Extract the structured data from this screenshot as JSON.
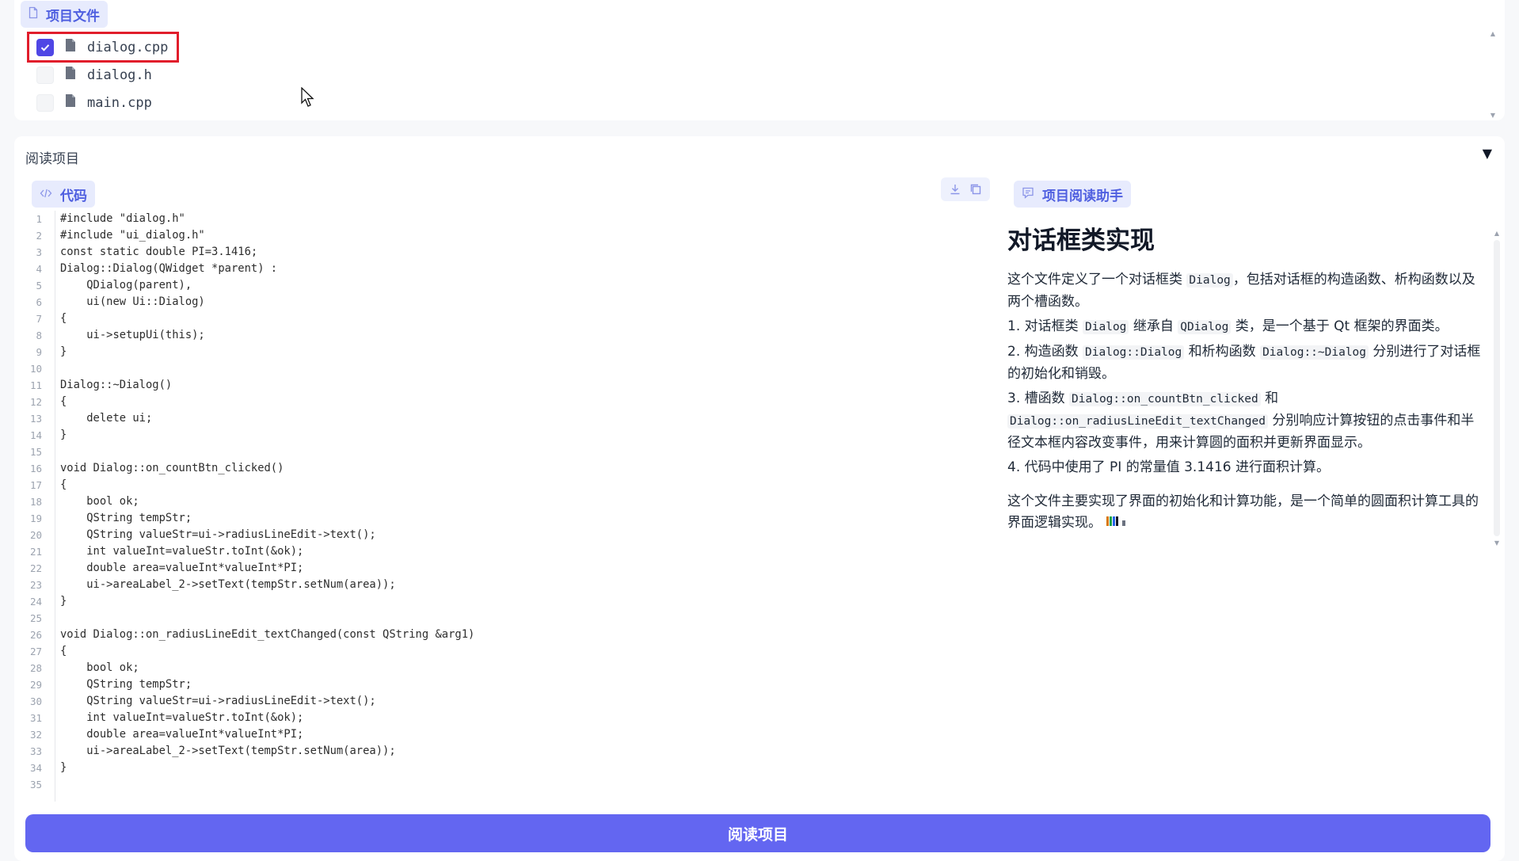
{
  "files_panel": {
    "label": "项目文件",
    "files": [
      {
        "name": "dialog.cpp",
        "checked": true
      },
      {
        "name": "dialog.h",
        "checked": false
      },
      {
        "name": "main.cpp",
        "checked": false
      }
    ]
  },
  "read_panel": {
    "header": "阅读项目",
    "collapse_icon": "▼",
    "code_label": "代码",
    "assistant_label": "项目阅读助手",
    "code_lines": [
      "#include \"dialog.h\"",
      "#include \"ui_dialog.h\"",
      "const static double PI=3.1416;",
      "Dialog::Dialog(QWidget *parent) :",
      "    QDialog(parent),",
      "    ui(new Ui::Dialog)",
      "{",
      "    ui->setupUi(this);",
      "}",
      "",
      "Dialog::~Dialog()",
      "{",
      "    delete ui;",
      "}",
      "",
      "void Dialog::on_countBtn_clicked()",
      "{",
      "    bool ok;",
      "    QString tempStr;",
      "    QString valueStr=ui->radiusLineEdit->text();",
      "    int valueInt=valueStr.toInt(&ok);",
      "    double area=valueInt*valueInt*PI;",
      "    ui->areaLabel_2->setText(tempStr.setNum(area));",
      "}",
      "",
      "void Dialog::on_radiusLineEdit_textChanged(const QString &arg1)",
      "{",
      "    bool ok;",
      "    QString tempStr;",
      "    QString valueStr=ui->radiusLineEdit->text();",
      "    int valueInt=valueStr.toInt(&ok);",
      "    double area=valueInt*valueInt*PI;",
      "    ui->areaLabel_2->setText(tempStr.setNum(area));",
      "}",
      ""
    ],
    "assistant": {
      "title": "对话框类实现",
      "intro_1": "这个文件定义了一个对话框类",
      "intro_code": "Dialog",
      "intro_2": "，包括对话框的构造函数、析构函数以及两个槽函数。",
      "p1_a": "1. 对话框类",
      "p1_code1": "Dialog",
      "p1_b": "继承自",
      "p1_code2": "QDialog",
      "p1_c": "类，是一个基于 Qt 框架的界面类。",
      "p2_a": "2. 构造函数",
      "p2_code1": "Dialog::Dialog",
      "p2_b": "和析构函数",
      "p2_code2": "Dialog::~Dialog",
      "p2_c": "分别进行了对话框的初始化和销毁。",
      "p3_a": "3. 槽函数",
      "p3_code1": "Dialog::on_countBtn_clicked",
      "p3_b": "和",
      "p3_code2": "Dialog::on_radiusLineEdit_textChanged",
      "p3_c": "分别响应计算按钮的点击事件和半径文本框内容改变事件，用来计算圆的面积并更新界面显示。",
      "p4": "4. 代码中使用了 PI 的常量值 3.1416 进行面积计算。",
      "summary": "这个文件主要实现了界面的初始化和计算功能，是一个简单的圆面积计算工具的界面逻辑实现。"
    },
    "read_button": "阅读项目"
  },
  "colors": {
    "accent": "#6366f1",
    "pill_bg": "#e7ebfd",
    "pill_text": "#4f5fe0",
    "selection_outline": "#e11d2b",
    "checkbox_checked": "#4f46e5"
  }
}
